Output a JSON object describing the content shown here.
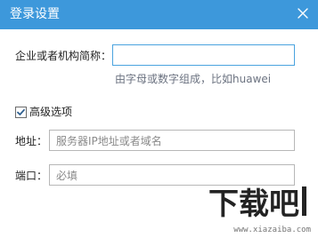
{
  "window": {
    "title": "登录设置",
    "close_icon": "close-icon",
    "accent": "#3d98db"
  },
  "form": {
    "company_label": "企业或者机构简称：",
    "company_value": "",
    "company_hint": "由字母或数字组成，比如huawei",
    "advanced_options": {
      "label": "高级选项",
      "checked": true
    },
    "address_label": "地址：",
    "address_placeholder": "服务器IP地址或者域名",
    "port_label": "端口：",
    "port_placeholder": "必填"
  },
  "watermark": {
    "main_text": "下载吧",
    "sub_text": "www.xiazaiba.com"
  }
}
